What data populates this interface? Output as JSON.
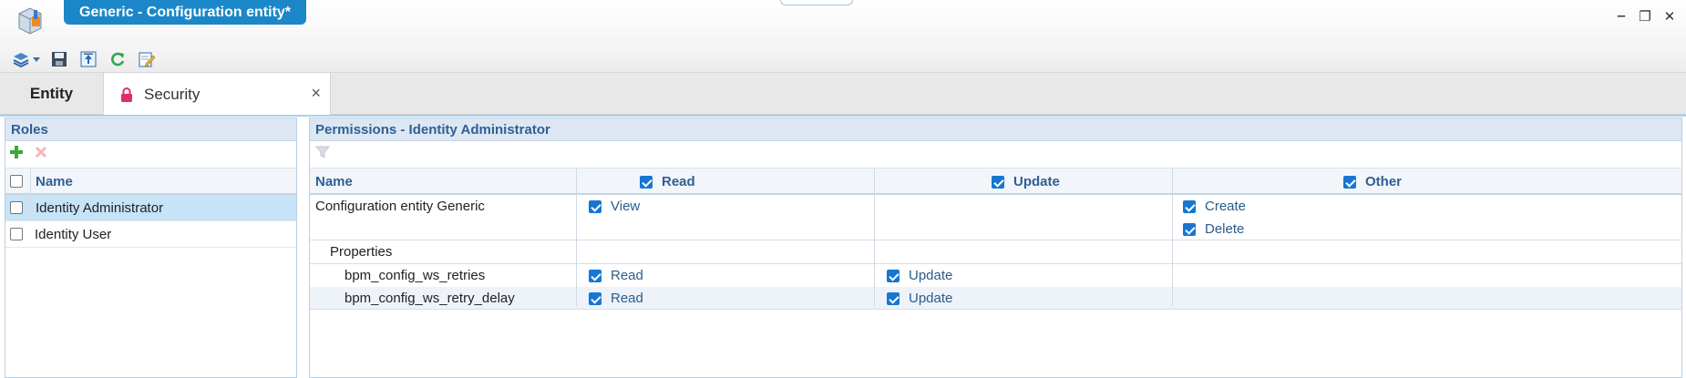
{
  "window": {
    "title": "Generic - Configuration entity*",
    "minimize": "‒",
    "restore": "❐",
    "close": "✕"
  },
  "toolbar": {
    "icons": [
      "layers-icon",
      "dropdown-arrow-icon",
      "save-icon",
      "export-icon",
      "refresh-icon",
      "edit-icon"
    ]
  },
  "tabs": {
    "entity": "Entity",
    "security": "Security",
    "close": "×"
  },
  "roles": {
    "header": "Roles",
    "column_name": "Name",
    "items": [
      {
        "name": "Identity Administrator",
        "selected": true
      },
      {
        "name": "Identity User",
        "selected": false
      }
    ]
  },
  "permissions": {
    "header": "Permissions - Identity Administrator",
    "columns": {
      "name": "Name",
      "read": "Read",
      "update": "Update",
      "other": "Other"
    },
    "rows": [
      {
        "name": "Configuration entity Generic",
        "read": "View",
        "other": [
          "Create",
          "Delete"
        ]
      },
      {
        "name": "Properties"
      },
      {
        "name": "bpm_config_ws_retries",
        "read": "Read",
        "update": "Update"
      },
      {
        "name": "bpm_config_ws_retry_delay",
        "read": "Read",
        "update": "Update"
      }
    ]
  },
  "colors": {
    "accent": "#1b87c9",
    "header_text": "#2f5f95",
    "selected_row": "#c6e3f7",
    "checkbox": "#1677d2"
  }
}
